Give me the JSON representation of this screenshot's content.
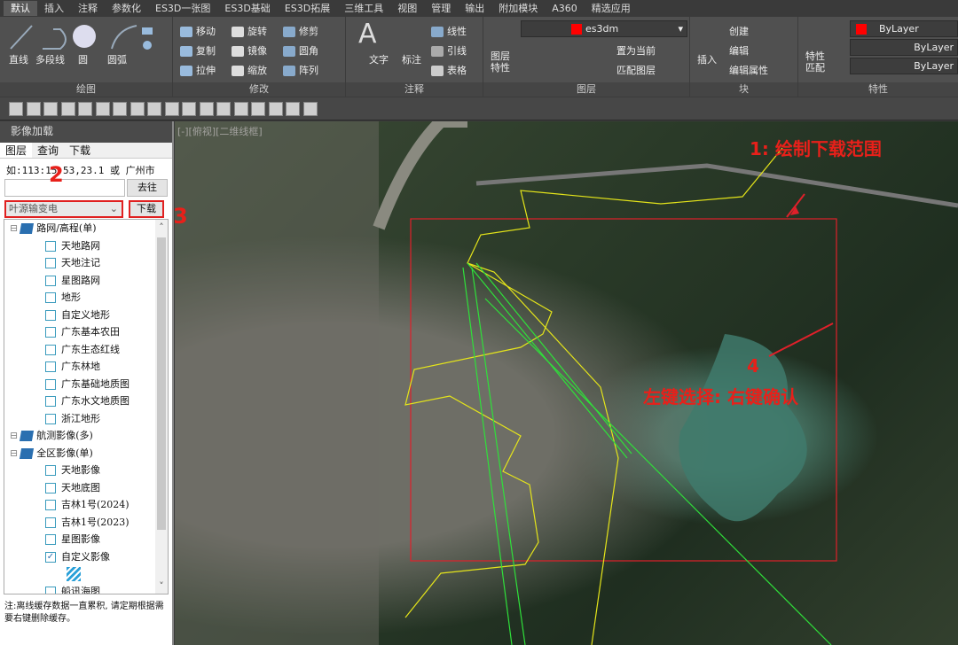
{
  "ribbon_tabs": [
    "默认",
    "插入",
    "注释",
    "参数化",
    "ES3D一张图",
    "ES3D基础",
    "ES3D拓展",
    "三维工具",
    "视图",
    "管理",
    "输出",
    "附加模块",
    "A360",
    "精选应用"
  ],
  "draw": {
    "label": "绘图",
    "items": [
      "直线",
      "多段线",
      "圆",
      "圆弧"
    ]
  },
  "modify": {
    "label": "修改",
    "items": [
      "移动",
      "旋转",
      "修剪",
      "复制",
      "镜像",
      "圆角",
      "拉伸",
      "缩放",
      "阵列"
    ]
  },
  "annotate": {
    "label": "注释",
    "text": "文字",
    "dim": "标注",
    "items": [
      "线性",
      "引线",
      "表格"
    ]
  },
  "layers": {
    "label": "图层",
    "props": "图层特性",
    "current_layer": "es3dm",
    "set_current": "置为当前",
    "match": "匹配图层"
  },
  "block": {
    "label": "块",
    "insert": "插入",
    "items": [
      "创建",
      "编辑",
      "编辑属性"
    ]
  },
  "properties": {
    "label": "特性",
    "match": "特性匹配",
    "color": "ByLayer",
    "linetype": "ByLayer",
    "lineweight": "ByLayer",
    "accent": "#ff0000"
  },
  "panel": {
    "title": "影像加载",
    "tabs": [
      "图层",
      "查询",
      "下载"
    ],
    "hint": "如:113:15:53,23.1 或 广州市",
    "search_value": "",
    "goto": "去往",
    "source": "叶源输变电",
    "download": "下载",
    "tree": [
      {
        "label": "路网/高程(单)",
        "level": 0,
        "type": "group"
      },
      {
        "label": "天地路网",
        "level": 1
      },
      {
        "label": "天地注记",
        "level": 1
      },
      {
        "label": "星图路网",
        "level": 1
      },
      {
        "label": "地形",
        "level": 1
      },
      {
        "label": "自定义地形",
        "level": 1
      },
      {
        "label": "广东基本农田",
        "level": 1
      },
      {
        "label": "广东生态红线",
        "level": 1
      },
      {
        "label": "广东林地",
        "level": 1
      },
      {
        "label": "广东基础地质图",
        "level": 1
      },
      {
        "label": "广东水文地质图",
        "level": 1
      },
      {
        "label": "浙江地形",
        "level": 1
      },
      {
        "label": "航测影像(多)",
        "level": 0,
        "type": "group"
      },
      {
        "label": "全区影像(单)",
        "level": 0,
        "type": "group"
      },
      {
        "label": "天地影像",
        "level": 1
      },
      {
        "label": "天地底图",
        "level": 1
      },
      {
        "label": "吉林1号(2024)",
        "level": 1
      },
      {
        "label": "吉林1号(2023)",
        "level": 1
      },
      {
        "label": "星图影像",
        "level": 1
      },
      {
        "label": "自定义影像",
        "level": 1,
        "checked": true
      },
      {
        "label": "",
        "level": 2,
        "type": "hatch"
      },
      {
        "label": "船讯海图",
        "level": 1
      }
    ],
    "note": "注:离线缓存数据一直累积, 请定期根据需要右键删除缓存。"
  },
  "viewport": {
    "label": "[-][俯视][二维线框]"
  },
  "annotations": {
    "a1": "1: 绘制下载范围",
    "a2": "2",
    "a3": "3",
    "a4": "4",
    "a4_text": "左键选择: 右键确认"
  }
}
